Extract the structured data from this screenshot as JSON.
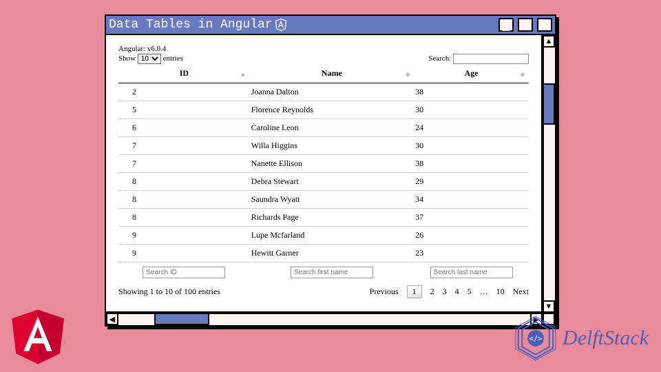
{
  "window": {
    "title": "Data Tables in Angular"
  },
  "meta": {
    "version_label": "Angular: v6.0.4"
  },
  "length": {
    "prefix": "Show",
    "selected": "10",
    "suffix": "entries"
  },
  "search": {
    "label": "Search:",
    "value": ""
  },
  "columns": {
    "id": "ID",
    "name": "Name",
    "age": "Age"
  },
  "rows": [
    {
      "id": "2",
      "name": "Joanna Dalton",
      "age": "38"
    },
    {
      "id": "5",
      "name": "Florence Reynolds",
      "age": "30"
    },
    {
      "id": "6",
      "name": "Caroline Leon",
      "age": "24"
    },
    {
      "id": "7",
      "name": "Willa Higgins",
      "age": "30"
    },
    {
      "id": "7",
      "name": "Nanette Ellison",
      "age": "38"
    },
    {
      "id": "8",
      "name": "Debra Stewart",
      "age": "29"
    },
    {
      "id": "8",
      "name": "Saundra Wyatt",
      "age": "34"
    },
    {
      "id": "8",
      "name": "Richards Page",
      "age": "37"
    },
    {
      "id": "9",
      "name": "Lupe Mcfarland",
      "age": "26"
    },
    {
      "id": "9",
      "name": "Hewitt Garner",
      "age": "23"
    }
  ],
  "footer_inputs": {
    "id_placeholder": "Search ID",
    "name_placeholder": "Search first name",
    "age_placeholder": "Search last name"
  },
  "info": "Showing 1 to 10 of 100 entries",
  "pager": {
    "prev": "Previous",
    "pages": [
      "1",
      "2",
      "3",
      "4",
      "5",
      "…",
      "10"
    ],
    "current_index": 0,
    "next": "Next"
  },
  "brand": {
    "delft_text": "DelftStack"
  }
}
